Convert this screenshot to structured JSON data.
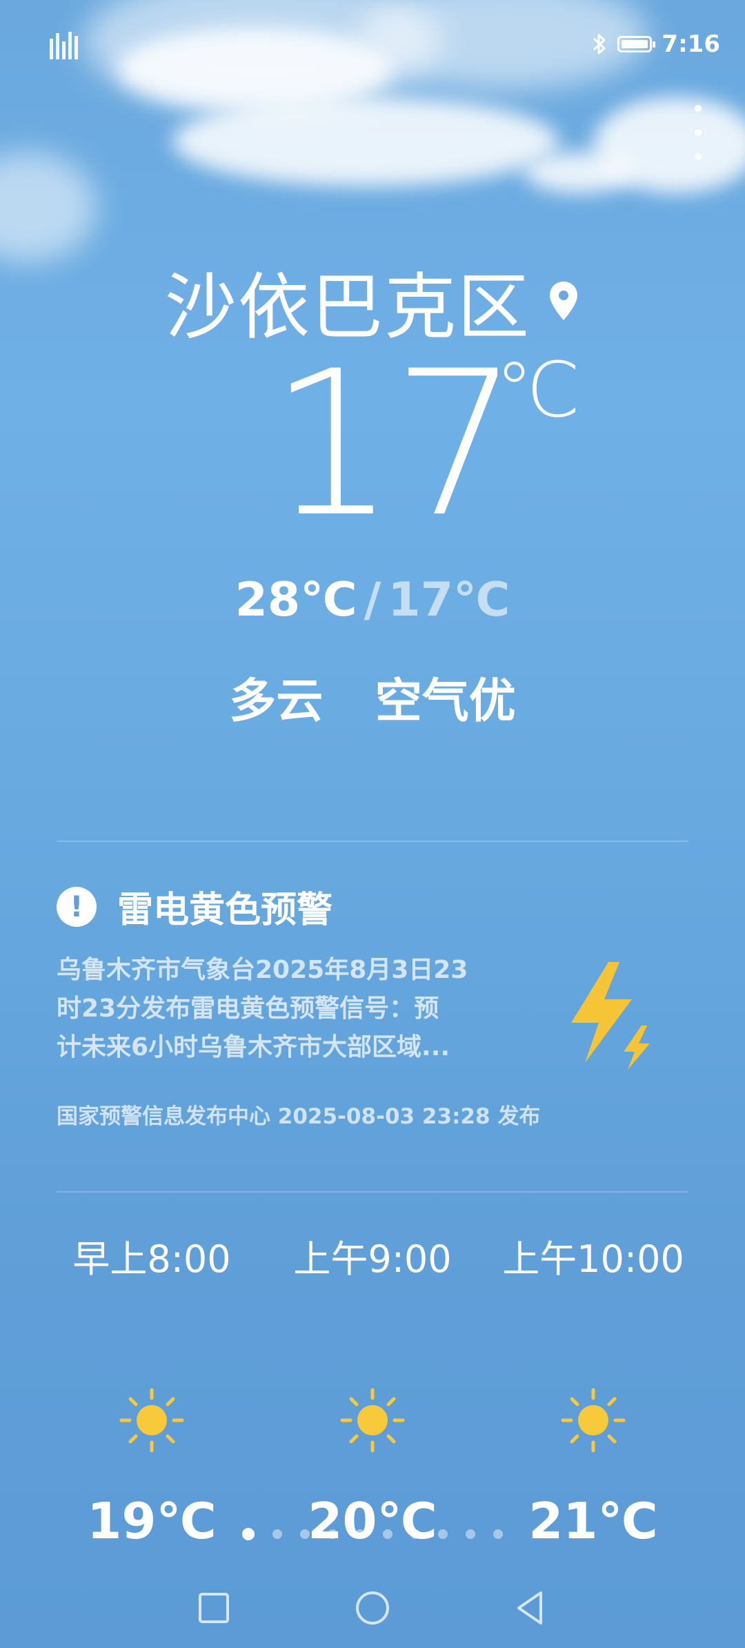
{
  "status_bar": {
    "time": "7:16",
    "icons": [
      "signal-icon",
      "bluetooth-icon",
      "battery-icon"
    ]
  },
  "location": {
    "city": "沙依巴克区",
    "icon": "location-pin-icon"
  },
  "current": {
    "temperature": "17",
    "unit": "℃",
    "high": "28℃",
    "separator": "/",
    "low": "17℃",
    "condition": "多云",
    "air_quality": "空气优"
  },
  "alert": {
    "icon": "alert-exclamation-icon",
    "title": "雷电黄色预警",
    "lines": [
      "乌鲁木齐市气象台2025年8月3日23",
      "时23分发布雷电黄色预警信号：预",
      "计未来6小时乌鲁木齐市大部区域..."
    ],
    "source": "国家预警信息发布中心 2025-08-03 23:28 发布",
    "illustration": "lightning-bolt-icon"
  },
  "hourly": [
    {
      "time": "早上8:00",
      "icon": "sun-icon",
      "temp": "19℃"
    },
    {
      "time": "上午9:00",
      "icon": "sun-icon",
      "temp": "20℃"
    },
    {
      "time": "上午10:00",
      "icon": "sun-icon",
      "temp": "21℃"
    }
  ],
  "pager": {
    "total": 10,
    "active": 0
  },
  "colors": {
    "sky_top": "#6aa8de",
    "sky_bottom": "#5c9bd6",
    "sun": "#f8c93a",
    "bolt": "#f6c437"
  }
}
